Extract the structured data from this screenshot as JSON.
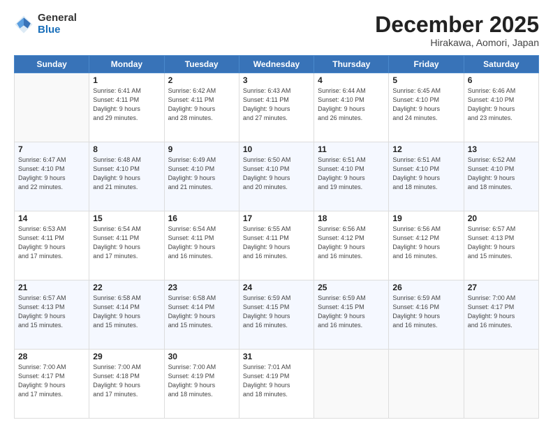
{
  "logo": {
    "general": "General",
    "blue": "Blue"
  },
  "header": {
    "month": "December 2025",
    "location": "Hirakawa, Aomori, Japan"
  },
  "weekdays": [
    "Sunday",
    "Monday",
    "Tuesday",
    "Wednesday",
    "Thursday",
    "Friday",
    "Saturday"
  ],
  "weeks": [
    [
      {
        "day": "",
        "info": ""
      },
      {
        "day": "1",
        "info": "Sunrise: 6:41 AM\nSunset: 4:11 PM\nDaylight: 9 hours\nand 29 minutes."
      },
      {
        "day": "2",
        "info": "Sunrise: 6:42 AM\nSunset: 4:11 PM\nDaylight: 9 hours\nand 28 minutes."
      },
      {
        "day": "3",
        "info": "Sunrise: 6:43 AM\nSunset: 4:11 PM\nDaylight: 9 hours\nand 27 minutes."
      },
      {
        "day": "4",
        "info": "Sunrise: 6:44 AM\nSunset: 4:10 PM\nDaylight: 9 hours\nand 26 minutes."
      },
      {
        "day": "5",
        "info": "Sunrise: 6:45 AM\nSunset: 4:10 PM\nDaylight: 9 hours\nand 24 minutes."
      },
      {
        "day": "6",
        "info": "Sunrise: 6:46 AM\nSunset: 4:10 PM\nDaylight: 9 hours\nand 23 minutes."
      }
    ],
    [
      {
        "day": "7",
        "info": "Sunrise: 6:47 AM\nSunset: 4:10 PM\nDaylight: 9 hours\nand 22 minutes."
      },
      {
        "day": "8",
        "info": "Sunrise: 6:48 AM\nSunset: 4:10 PM\nDaylight: 9 hours\nand 21 minutes."
      },
      {
        "day": "9",
        "info": "Sunrise: 6:49 AM\nSunset: 4:10 PM\nDaylight: 9 hours\nand 21 minutes."
      },
      {
        "day": "10",
        "info": "Sunrise: 6:50 AM\nSunset: 4:10 PM\nDaylight: 9 hours\nand 20 minutes."
      },
      {
        "day": "11",
        "info": "Sunrise: 6:51 AM\nSunset: 4:10 PM\nDaylight: 9 hours\nand 19 minutes."
      },
      {
        "day": "12",
        "info": "Sunrise: 6:51 AM\nSunset: 4:10 PM\nDaylight: 9 hours\nand 18 minutes."
      },
      {
        "day": "13",
        "info": "Sunrise: 6:52 AM\nSunset: 4:10 PM\nDaylight: 9 hours\nand 18 minutes."
      }
    ],
    [
      {
        "day": "14",
        "info": "Sunrise: 6:53 AM\nSunset: 4:11 PM\nDaylight: 9 hours\nand 17 minutes."
      },
      {
        "day": "15",
        "info": "Sunrise: 6:54 AM\nSunset: 4:11 PM\nDaylight: 9 hours\nand 17 minutes."
      },
      {
        "day": "16",
        "info": "Sunrise: 6:54 AM\nSunset: 4:11 PM\nDaylight: 9 hours\nand 16 minutes."
      },
      {
        "day": "17",
        "info": "Sunrise: 6:55 AM\nSunset: 4:11 PM\nDaylight: 9 hours\nand 16 minutes."
      },
      {
        "day": "18",
        "info": "Sunrise: 6:56 AM\nSunset: 4:12 PM\nDaylight: 9 hours\nand 16 minutes."
      },
      {
        "day": "19",
        "info": "Sunrise: 6:56 AM\nSunset: 4:12 PM\nDaylight: 9 hours\nand 16 minutes."
      },
      {
        "day": "20",
        "info": "Sunrise: 6:57 AM\nSunset: 4:13 PM\nDaylight: 9 hours\nand 15 minutes."
      }
    ],
    [
      {
        "day": "21",
        "info": "Sunrise: 6:57 AM\nSunset: 4:13 PM\nDaylight: 9 hours\nand 15 minutes."
      },
      {
        "day": "22",
        "info": "Sunrise: 6:58 AM\nSunset: 4:14 PM\nDaylight: 9 hours\nand 15 minutes."
      },
      {
        "day": "23",
        "info": "Sunrise: 6:58 AM\nSunset: 4:14 PM\nDaylight: 9 hours\nand 15 minutes."
      },
      {
        "day": "24",
        "info": "Sunrise: 6:59 AM\nSunset: 4:15 PM\nDaylight: 9 hours\nand 16 minutes."
      },
      {
        "day": "25",
        "info": "Sunrise: 6:59 AM\nSunset: 4:15 PM\nDaylight: 9 hours\nand 16 minutes."
      },
      {
        "day": "26",
        "info": "Sunrise: 6:59 AM\nSunset: 4:16 PM\nDaylight: 9 hours\nand 16 minutes."
      },
      {
        "day": "27",
        "info": "Sunrise: 7:00 AM\nSunset: 4:17 PM\nDaylight: 9 hours\nand 16 minutes."
      }
    ],
    [
      {
        "day": "28",
        "info": "Sunrise: 7:00 AM\nSunset: 4:17 PM\nDaylight: 9 hours\nand 17 minutes."
      },
      {
        "day": "29",
        "info": "Sunrise: 7:00 AM\nSunset: 4:18 PM\nDaylight: 9 hours\nand 17 minutes."
      },
      {
        "day": "30",
        "info": "Sunrise: 7:00 AM\nSunset: 4:19 PM\nDaylight: 9 hours\nand 18 minutes."
      },
      {
        "day": "31",
        "info": "Sunrise: 7:01 AM\nSunset: 4:19 PM\nDaylight: 9 hours\nand 18 minutes."
      },
      {
        "day": "",
        "info": ""
      },
      {
        "day": "",
        "info": ""
      },
      {
        "day": "",
        "info": ""
      }
    ]
  ]
}
